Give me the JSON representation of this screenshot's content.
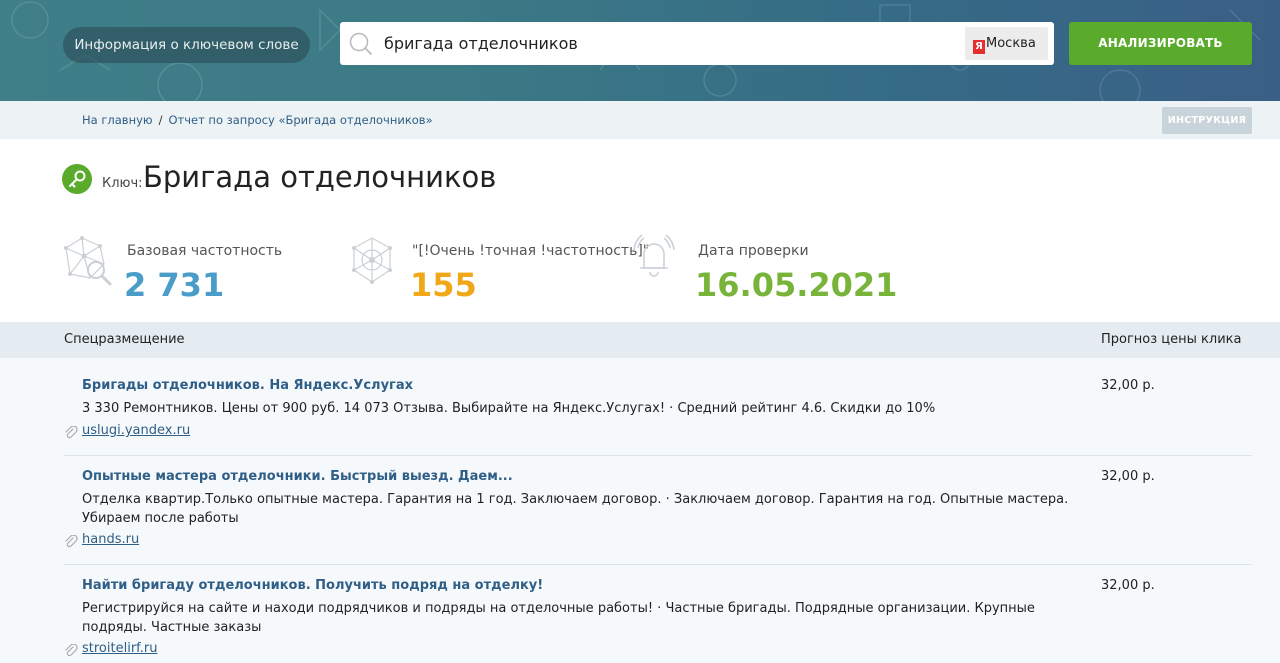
{
  "header": {
    "keyword_info_label": "Информация о ключевом слове",
    "search_value": "бригада отделочников",
    "region_prefix": "Я",
    "region": "Москва",
    "analyze_label": "АНАЛИЗИРОВАТЬ"
  },
  "breadcrumb": {
    "home": "На главную",
    "separator": "/",
    "current": "Отчет по запросу «Бригада отделочников»"
  },
  "instruction_label": "ИНСТРУКЦИЯ",
  "key": {
    "prefix": "Ключ:",
    "title": "Бригада отделочников"
  },
  "stats": {
    "base": {
      "label": "Базовая частотность",
      "value": "2 731",
      "color": "#4a9cc9"
    },
    "exact": {
      "label": "\"[!Очень !точная !частотность]\"",
      "value": "155",
      "color": "#f0a818"
    },
    "date": {
      "label": "Дата проверки",
      "value": "16.05.2021",
      "color": "#78b43a"
    }
  },
  "table": {
    "col_left": "Спецразмещение",
    "col_right": "Прогноз цены клика",
    "rows": [
      {
        "title": "Бригады отделочников. На Яндекс.Услугах",
        "desc": "3 330 Ремонтников. Цены от 900 руб. 14 073 Отзыва. Выбирайте на Яндекс.Услугах! · Средний рейтинг 4.6. Скидки до 10%",
        "domain": "uslugi.yandex.ru",
        "price": "32,00 р."
      },
      {
        "title": "Опытные мастера отделочники. Быстрый выезд. Даем...",
        "desc": "Отделка квартир.Только опытные мастера. Гарантия на 1 год. Заключаем договор. · Заключаем договор. Гарантия на год. Опытные мастера. Убираем после работы",
        "domain": "hands.ru",
        "price": "32,00 р."
      },
      {
        "title": "Найти бригаду отделочников. Получить подряд на отделку!",
        "desc": "Регистрируйся на сайте и находи подрядчиков и подряды на отделочные работы! · Частные бригады. Подрядные организации. Крупные подряды. Частные заказы",
        "domain": "stroitelirf.ru",
        "price": "32,00 р."
      }
    ]
  },
  "colors": {
    "accent_green": "#5aaa2c",
    "link_blue": "#2f5e86"
  }
}
